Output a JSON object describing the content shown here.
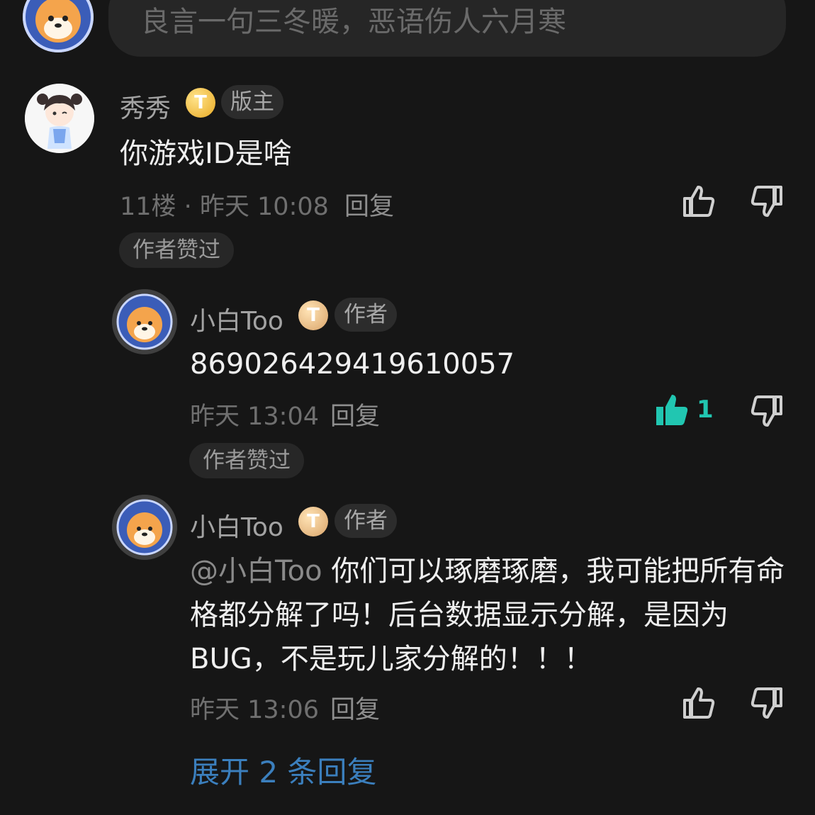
{
  "input": {
    "placeholder": "良言一句三冬暖，恶语伤人六月寒"
  },
  "comments": [
    {
      "author": "秀秀",
      "badge": "T",
      "role": "版主",
      "text": "你游戏ID是啥",
      "meta": "11楼 · 昨天 10:08",
      "reply_label": "回复",
      "liked_label": "作者赞过"
    },
    {
      "author": "小白Too",
      "badge": "T",
      "role": "作者",
      "text": "869026429419610057",
      "meta": "昨天 13:04",
      "reply_label": "回复",
      "like_count": "1",
      "liked_label": "作者赞过"
    },
    {
      "author": "小白Too",
      "badge": "T",
      "role": "作者",
      "mention": "@小白Too",
      "text": "你们可以琢磨琢磨，我可能把所有命格都分解了吗！后台数据显示分解，是因为BUG，不是玩儿家分解的！！！",
      "meta": "昨天 13:06",
      "reply_label": "回复"
    }
  ],
  "expand_label": "展开 2 条回复",
  "colors": {
    "accent": "#21c6b1",
    "link": "#3b7fbd",
    "background": "#161616"
  },
  "icons": [
    "thumbs-up-icon",
    "thumbs-down-icon",
    "thumbs-up-filled-icon"
  ]
}
